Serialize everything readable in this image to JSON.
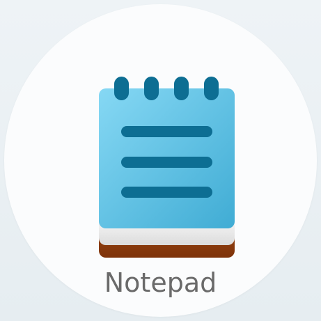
{
  "app": {
    "name": "Notepad",
    "icon": "notepad-icon"
  },
  "colors": {
    "cover_light": "#7fd3f1",
    "cover_dark": "#43afd6",
    "lines_and_rings": "#0d6e93",
    "pages": "#f4f4f4",
    "back_cover": "#8e3c0d"
  }
}
